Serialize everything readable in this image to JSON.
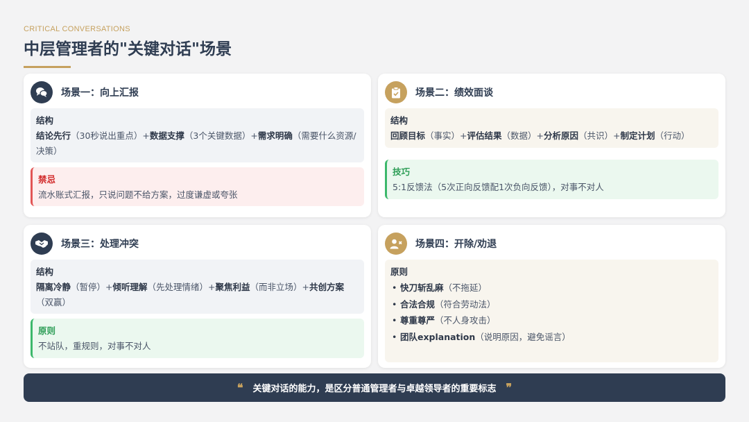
{
  "header": {
    "kicker": "CRITICAL CONVERSATIONS",
    "title": "中层管理者的\"关键对话\"场景"
  },
  "cards": [
    {
      "title": "场景一：向上汇报",
      "icon": "chat-bubbles-icon",
      "structure": {
        "label": "结构",
        "parts": [
          {
            "b": "结论先行",
            "n": "（30秒说出重点）+"
          },
          {
            "b": "数据支撑",
            "n": "（3个关键数据）+"
          },
          {
            "b": "需求明确",
            "n": "（需要什么资源/决策）"
          }
        ]
      },
      "note": {
        "label": "禁忌",
        "text": "流水账式汇报，只说问题不给方案，过度谦虚或夸张"
      }
    },
    {
      "title": "场景二：绩效面谈",
      "icon": "clipboard-check-icon",
      "structure": {
        "label": "结构",
        "parts": [
          {
            "b": "回顾目标",
            "n": "（事实）+"
          },
          {
            "b": "评估结果",
            "n": "（数据）+"
          },
          {
            "b": "分析原因",
            "n": "（共识）+"
          },
          {
            "b": "制定计划",
            "n": "（行动）"
          }
        ]
      },
      "note": {
        "label": "技巧",
        "text": "5:1反馈法（5次正向反馈配1次负向反馈），对事不对人"
      }
    },
    {
      "title": "场景三：处理冲突",
      "icon": "handshake-icon",
      "structure": {
        "label": "结构",
        "parts": [
          {
            "b": "隔离冷静",
            "n": "（暂停）+"
          },
          {
            "b": "倾听理解",
            "n": "（先处理情绪）+"
          },
          {
            "b": "聚焦利益",
            "n": "（而非立场）+"
          },
          {
            "b": "共创方案",
            "n": "（双赢）"
          }
        ]
      },
      "note": {
        "label": "原则",
        "text": "不站队，重规则，对事不对人"
      }
    },
    {
      "title": "场景四：开除/劝退",
      "icon": "user-remove-icon",
      "principles": {
        "label": "原则",
        "items": [
          {
            "b": "快刀斩乱麻",
            "n": "（不拖延）"
          },
          {
            "b": "合法合规",
            "n": "（符合劳动法）"
          },
          {
            "b": "尊重尊严",
            "n": "（不人身攻击）"
          },
          {
            "b": "团队explanation",
            "n": "（说明原因，避免谣言）"
          }
        ]
      }
    }
  ],
  "footer": {
    "open_quote": "❝",
    "text": "关键对话的能力，是区分普通管理者与卓越领导者的重要标志",
    "close_quote": "❞"
  },
  "colors": {
    "navy": "#2f3d52",
    "gold": "#c6a15e",
    "danger": "#d32f2f",
    "success": "#2e9e57"
  }
}
